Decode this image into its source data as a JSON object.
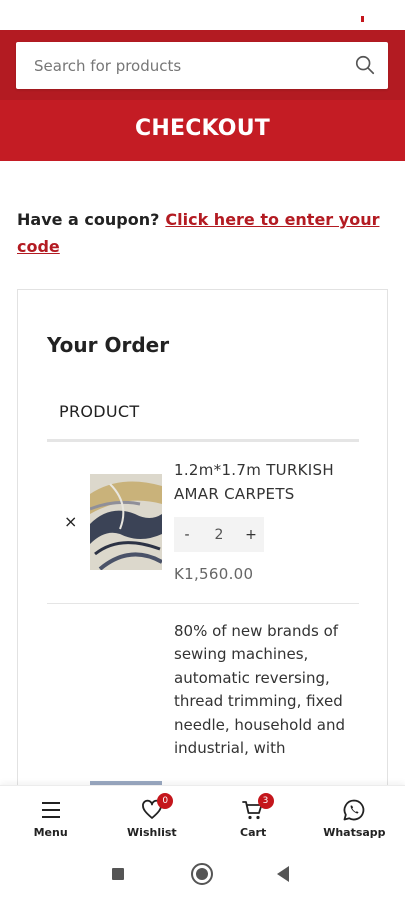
{
  "search": {
    "placeholder": "Search for products"
  },
  "page": {
    "title": "CHECKOUT"
  },
  "coupon": {
    "question": "Have a coupon?",
    "link": "Click here to enter your code"
  },
  "order": {
    "heading": "Your Order",
    "column_header": "PRODUCT",
    "items": [
      {
        "remove_glyph": "×",
        "name": "1.2m*1.7m TURKISH AMAR CARPETS",
        "quantity": "2",
        "minus": "-",
        "plus": "+",
        "price": "K1,560.00"
      },
      {
        "description": "80% of new brands of sewing machines, automatic reversing, thread trimming, fixed needle, household and industrial, with"
      }
    ]
  },
  "bottom_nav": {
    "items": [
      {
        "label": "Menu",
        "icon": "menu-icon"
      },
      {
        "label": "Wishlist",
        "icon": "heart-icon",
        "badge": "0"
      },
      {
        "label": "Cart",
        "icon": "cart-icon",
        "badge": "3"
      },
      {
        "label": "Whatsapp",
        "icon": "whatsapp-icon"
      }
    ]
  },
  "colors": {
    "brand_red": "#c41c24",
    "brand_red_dark": "#b31b22",
    "link_red": "#b31b22"
  }
}
